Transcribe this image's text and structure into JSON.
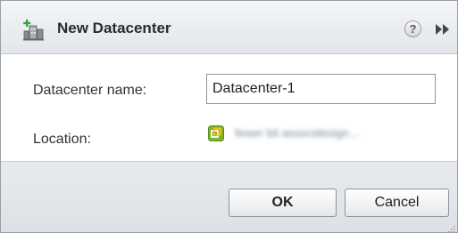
{
  "dialog": {
    "title": "New Datacenter",
    "title_icon": "datacenter-add-icon",
    "help_icon": "help-icon",
    "help_glyph": "?",
    "expand_icon": "fast-forward-icon"
  },
  "form": {
    "name_label": "Datacenter name:",
    "name_value": "Datacenter-1",
    "location_label": "Location:",
    "location_icon": "vcenter-icon",
    "location_value": "fewer bit associdesign..."
  },
  "footer": {
    "ok_label": "OK",
    "cancel_label": "Cancel",
    "resize_icon": "resize-grip-icon"
  }
}
